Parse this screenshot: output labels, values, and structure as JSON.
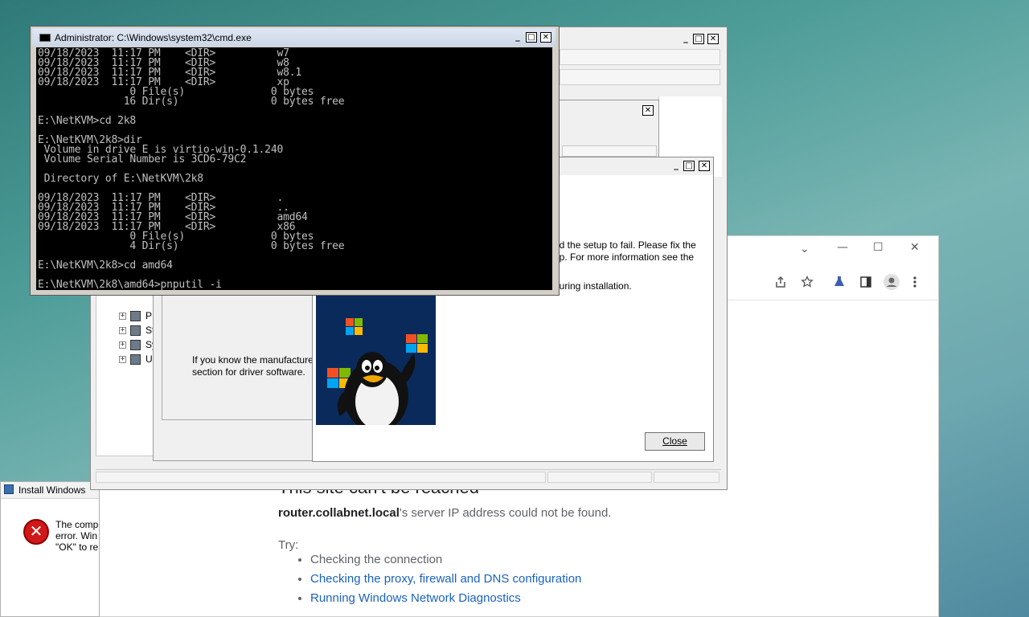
{
  "chrome": {
    "error_title": "This site can't be reached",
    "host": "router.collabnet.local",
    "host_suffix": "'s server IP address could not be found.",
    "try_label": "Try:",
    "suggestions": [
      {
        "text": "Checking the connection",
        "link": false
      },
      {
        "text": "Checking the proxy, firewall and DNS configuration",
        "link": true
      },
      {
        "text": "Running Windows Network Diagnostics",
        "link": true
      }
    ],
    "window_controls": {
      "minimize": "—",
      "maximize": "☐",
      "close": "✕",
      "tab_search": "⌄"
    },
    "toolbar_icons": [
      "share-icon",
      "bookmark-star-icon",
      "extensions-icon",
      "sidebar-icon",
      "profile-icon",
      "menu-icon"
    ]
  },
  "install_dialog": {
    "title": "Install Windows",
    "message_lines": [
      "The comp",
      "error. Win",
      "\"OK\" to re"
    ]
  },
  "device_manager": {
    "tree_items": [
      {
        "label": "P"
      },
      {
        "label": "St"
      },
      {
        "label": "Sy"
      },
      {
        "label": "U"
      }
    ]
  },
  "wizard": {
    "description_lines": [
      "If you know the manufacture",
      "section for driver software."
    ]
  },
  "failure_dialog": {
    "text_lines": [
      "ed the setup to fail. Please fix the",
      "up. For more information see the"
    ],
    "text_line2": "during installation.",
    "close_label": "Close"
  },
  "cmd": {
    "title": "Administrator: C:\\Windows\\system32\\cmd.exe",
    "lines": [
      "09/18/2023  11:17 PM    <DIR>          w7",
      "09/18/2023  11:17 PM    <DIR>          w8",
      "09/18/2023  11:17 PM    <DIR>          w8.1",
      "09/18/2023  11:17 PM    <DIR>          xp",
      "               0 File(s)              0 bytes",
      "              16 Dir(s)               0 bytes free",
      "",
      "E:\\NetKVM>cd 2k8",
      "",
      "E:\\NetKVM\\2k8>dir",
      " Volume in drive E is virtio-win-0.1.240",
      " Volume Serial Number is 3CD6-79C2",
      "",
      " Directory of E:\\NetKVM\\2k8",
      "",
      "09/18/2023  11:17 PM    <DIR>          .",
      "09/18/2023  11:17 PM    <DIR>          ..",
      "09/18/2023  11:17 PM    <DIR>          amd64",
      "09/18/2023  11:17 PM    <DIR>          x86",
      "               0 File(s)              0 bytes",
      "               4 Dir(s)               0 bytes free",
      "",
      "E:\\NetKVM\\2k8>cd amd64",
      "",
      "E:\\NetKVM\\2k8\\amd64>pnputil -i"
    ]
  },
  "colors": {
    "link": "#1a62c0",
    "console_bg": "#000000",
    "console_fg": "#c0c0c0",
    "error_red": "#d01818",
    "tux_bg": "#0a2a5c"
  }
}
